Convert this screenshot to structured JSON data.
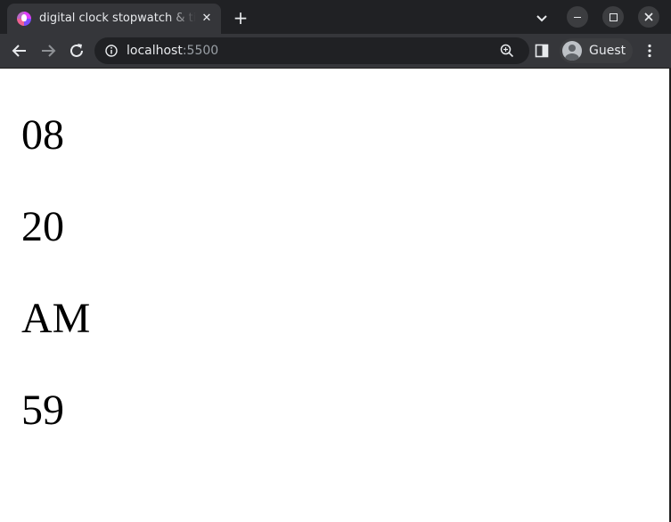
{
  "browser": {
    "tab": {
      "title": "digital clock stopwatch & timer"
    },
    "address_bar": {
      "host": "localhost",
      "port": ":5500"
    },
    "profile": {
      "name": "Guest"
    },
    "icons": {
      "favicon": "app-favicon-icon",
      "tab_close": "close-icon",
      "new_tab": "plus-icon",
      "tab_search": "chevron-down-icon",
      "minimize": "minimize-icon",
      "maximize": "maximize-icon",
      "close": "close-icon",
      "back": "arrow-left-icon",
      "forward": "arrow-right-icon",
      "reload": "reload-icon",
      "site_info": "info-icon",
      "zoom": "zoom-icon",
      "side_panel": "side-panel-icon",
      "avatar": "avatar-icon",
      "menu": "kebab-menu-icon"
    },
    "colors": {
      "tabstrip": "#202124",
      "toolbar": "#35363a",
      "omnibox": "#202124",
      "text": "#e8eaed",
      "muted_text": "#9aa0a6"
    }
  },
  "clock": {
    "hours": "08",
    "minutes": "20",
    "ampm": "AM",
    "seconds": "59"
  }
}
